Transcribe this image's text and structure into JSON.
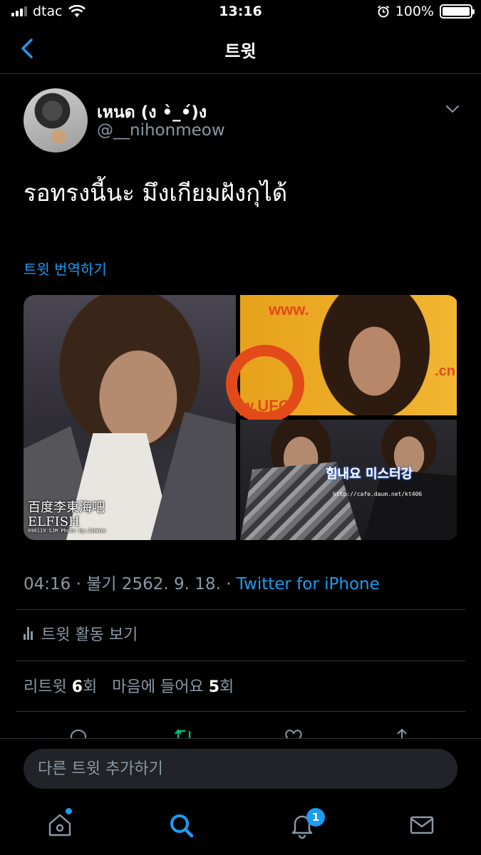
{
  "status_bar": {
    "carrier": "dtac",
    "time": "13:16",
    "battery": "100%",
    "battery_level": 1.0
  },
  "nav": {
    "title": "트윗"
  },
  "tweet": {
    "display_name": "เหนด (ง •̀_•́)ง",
    "handle": "@__nihonmeow",
    "text": "รอทรงนี้นะ มึงเกียมฝังกุได้",
    "translate_label": "트윗 번역하기",
    "media": [
      {
        "watermark": "百度李東海吧",
        "watermark2": "ELFISH",
        "watermark_small": "090119 SJM Photo by:Jimmie"
      },
      {
        "watermark": "www.",
        "watermark2": "w.UFO",
        "watermark3": ".cn"
      },
      {
        "watermark": "힘내요 미스터강",
        "watermark_small": "http://cafe.daum.net/kt406"
      }
    ],
    "meta_time": "04:16 · 불기 2562. 9. 18. · ",
    "meta_source": "Twitter for iPhone",
    "activity_label": "트윗 활동 보기",
    "retweets_label": "리트윗",
    "retweets_count": "6",
    "retweets_unit": "회",
    "likes_label": "마음에 들어요",
    "likes_count": "5",
    "likes_unit": "회"
  },
  "reply": {
    "placeholder": "다른 트윗 추가하기"
  },
  "tabbar": {
    "notifications_badge": "1"
  },
  "colors": {
    "accent": "#1d9bf0",
    "background": "#000000",
    "muted": "#8b98a5",
    "retweet_green": "#00ba7c"
  }
}
